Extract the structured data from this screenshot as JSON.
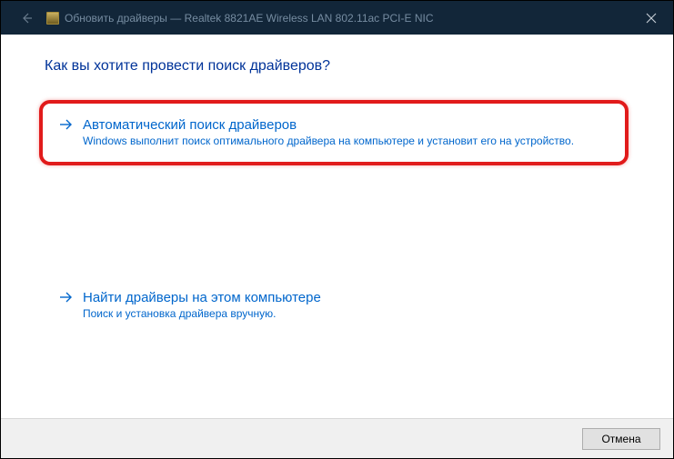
{
  "titlebar": {
    "back_icon": "←",
    "title": "Обновить драйверы — Realtek 8821AE Wireless LAN 802.11ac PCI-E NIC",
    "close_icon": "✕"
  },
  "heading": "Как вы хотите провести поиск драйверов?",
  "options": [
    {
      "title": "Автоматический поиск драйверов",
      "desc": "Windows выполнит поиск оптимального драйвера на компьютере и установит его на устройство."
    },
    {
      "title": "Найти драйверы на этом компьютере",
      "desc": "Поиск и установка драйвера вручную."
    }
  ],
  "footer": {
    "cancel": "Отмена"
  }
}
